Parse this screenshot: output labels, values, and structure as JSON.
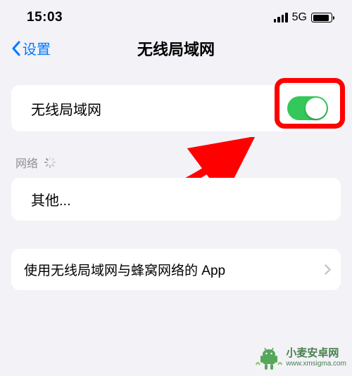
{
  "status": {
    "time": "15:03",
    "network": "5G"
  },
  "nav": {
    "back": "设置",
    "title": "无线局域网"
  },
  "wifi_row": {
    "label": "无线局域网",
    "enabled": true
  },
  "networks": {
    "header": "网络",
    "other": "其他..."
  },
  "apps_row": {
    "label": "使用无线局域网与蜂窝网络的 App"
  },
  "watermark": {
    "name": "小麦安卓网",
    "url": "www.xmsigma.com"
  }
}
